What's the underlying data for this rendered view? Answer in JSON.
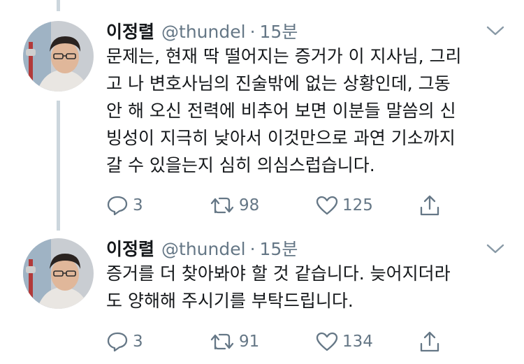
{
  "tweets": [
    {
      "name": "이정렬",
      "handle": "@thundel",
      "separator": "·",
      "time": "15분",
      "lines": [
        "문제는, 현재 딱 떨어지는 증거가 이 지사님, 그리",
        "고 나 변호사님의 진술밖에 없는 상황인데, 그동",
        "안 해 오신 전력에 비추어 보면 이분들 말씀의 신",
        "빙성이 지극히 낮아서 이것만으로 과연 기소까지",
        "갈 수 있을는지 심히 의심스럽습니다."
      ],
      "reply_count": "3",
      "retweet_count": "98",
      "like_count": "125"
    },
    {
      "name": "이정렬",
      "handle": "@thundel",
      "separator": "·",
      "time": "15분",
      "lines": [
        "증거를 더 찾아봐야 할 것 같습니다. 늦어지더라",
        "도 양해해 주시기를 부탁드립니다."
      ],
      "reply_count": "3",
      "retweet_count": "91",
      "like_count": "134"
    }
  ],
  "icons": {
    "reply": "reply-icon",
    "retweet": "retweet-icon",
    "like": "like-icon",
    "share": "share-icon",
    "menu": "chevron-down-icon"
  },
  "colors": {
    "text": "#14171a",
    "muted": "#657786",
    "thread_line": "#ccd6dd"
  }
}
